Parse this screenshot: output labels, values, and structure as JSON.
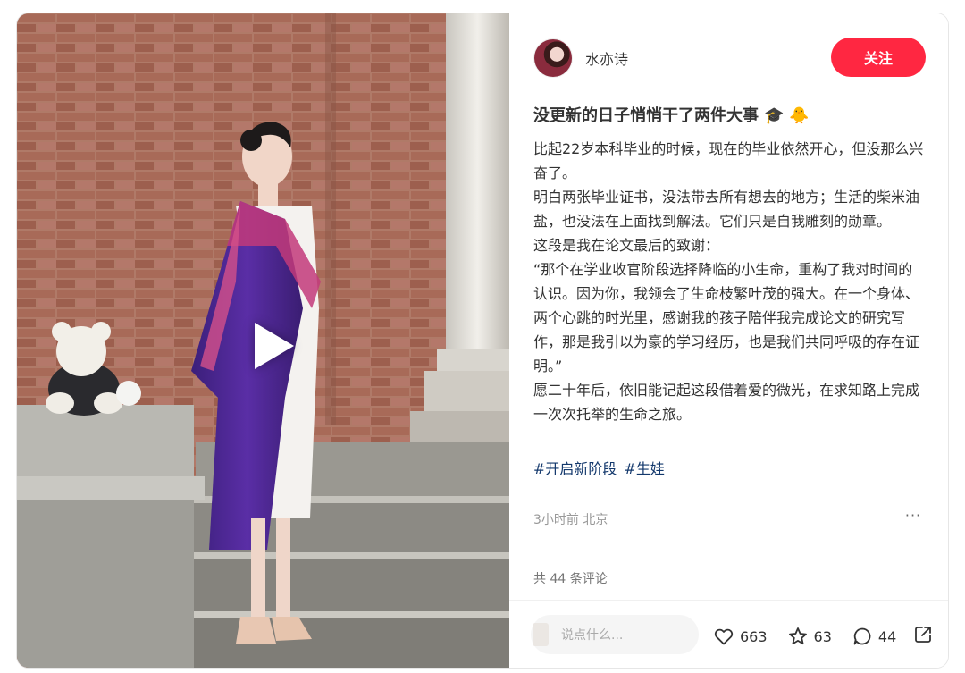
{
  "author": {
    "name": "水亦诗",
    "avatar": "avatar"
  },
  "follow_label": "关注",
  "post": {
    "title": "没更新的日子悄悄干了两件大事",
    "title_emojis": [
      "🎓",
      "🐥"
    ],
    "paragraphs": [
      "比起22岁本科毕业的时候，现在的毕业依然开心，但没那么兴奋了。",
      "明白两张毕业证书，没法带去所有想去的地方；生活的柴米油盐，也没法在上面找到解法。它们只是自我雕刻的勋章。",
      "这段是我在论文最后的致谢：",
      "“那个在学业收官阶段选择降临的小生命，重构了我对时间的认识。因为你，我领会了生命枝繁叶茂的强大。在一个身体、两个心跳的时光里，感谢我的孩子陪伴我完成论文的研究写作，那是我引以为豪的学习经历，也是我们共同呼吸的存在证明。”",
      "愿二十年后，依旧能记起这段借着爱的微光，在求知路上完成一次次托举的生命之旅。"
    ],
    "tags": [
      "#开启新阶段",
      "#生娃"
    ],
    "meta": "3小时前 北京"
  },
  "comments": {
    "count_text": "共 44 条评论",
    "input_placeholder": "说点什么..."
  },
  "stats": {
    "likes": "663",
    "collects": "63",
    "comments": "44"
  },
  "icons": {
    "play": "play-icon",
    "like": "heart-icon",
    "collect": "star-icon",
    "comment": "comment-bubble-icon",
    "share": "share-icon",
    "more": "more-dots-icon"
  },
  "colors": {
    "accent": "#ff2741",
    "tag": "#13386c",
    "muted": "#999999"
  }
}
